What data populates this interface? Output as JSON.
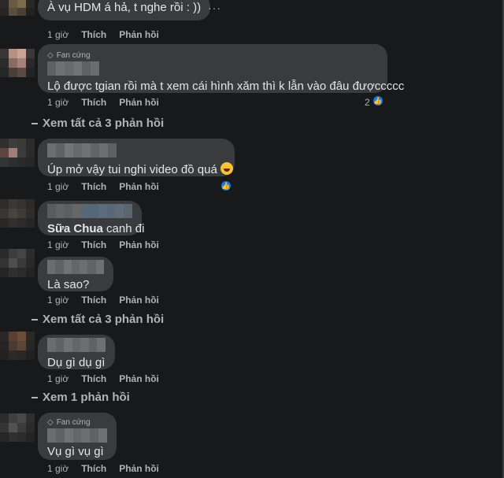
{
  "actions": {
    "time": "1 giờ",
    "like": "Thích",
    "reply": "Phản hồi"
  },
  "badge_label": "Fan cứng",
  "comments": [
    {
      "text": "À vụ HDM á hả, t nghe rồi : ))"
    },
    {
      "text": "Lộ được tgian rồi mà t xem cái hình xăm thì k lẫn vào đâu đượccccc",
      "reaction_count": "2"
    },
    {
      "text": "Úp mở vậy tui nghi video đồ quá"
    },
    {
      "mention": "Sữa Chua",
      "text": " canh đi"
    },
    {
      "text": "Là sao?"
    },
    {
      "text": "Dụ gì dụ gì"
    },
    {
      "text": "Vụ gì vụ gì"
    }
  ],
  "view_replies": [
    "Xem tất cả 3 phản hồi",
    "Xem tất cả 3 phản hồi",
    "Xem 1 phản hồi"
  ],
  "more_dots": "···",
  "icons": {
    "like": "thumbs-up-icon",
    "badge": "diamond-icon",
    "emoji": "grin-emoji-icon"
  },
  "colors": {
    "background": "#18191a",
    "bubble": "#3a3b3c",
    "text": "#e4e6eb",
    "muted": "#b0b3b8",
    "like_blue": "#1877f2"
  }
}
